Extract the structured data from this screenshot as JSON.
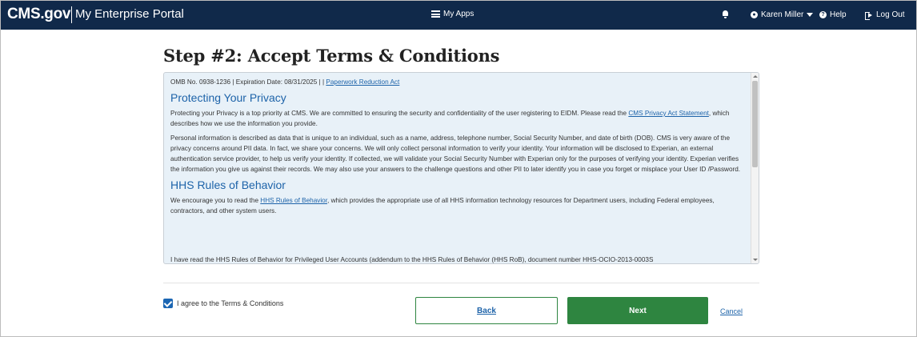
{
  "header": {
    "brand": "CMS.gov",
    "portal": "My Enterprise Portal",
    "my_apps": "My Apps",
    "user_name": "Karen Miller",
    "help": "Help",
    "logout": "Log Out"
  },
  "page": {
    "title": "Step #2: Accept Terms & Conditions"
  },
  "terms": {
    "omb_line": "OMB No. 0938-1236 | Expiration Date: 08/31/2025 | |",
    "omb_link": "Paperwork Reduction Act",
    "privacy_heading": "Protecting Your Privacy",
    "privacy_p1_pre": "Protecting your Privacy is a top priority at CMS. We are committed to ensuring the security and confidentiality of the user registering to EIDM. Please read the",
    "privacy_p1_link": "CMS Privacy Act Statement",
    "privacy_p1_post": ", which describes how we use the information you provide.",
    "privacy_p2": "Personal information is described as data that is unique to an individual, such as a name, address, telephone number, Social Security Number, and date of birth (DOB). CMS is very aware of the privacy concerns around PII data. In fact, we share your concerns. We will only collect personal information to verify your identity. Your information will be disclosed to Experian, an external authentication service provider, to help us verify your identity. If collected, we will validate your Social Security Number with Experian only for the purposes of verifying your identity. Experian verifies the information you give us against their records. We may also use your answers to the challenge questions and other PII to later identify you in case you forget or misplace your User ID /Password.",
    "hhs_heading": "HHS Rules of Behavior",
    "hhs_p1_pre": "We encourage you to read the",
    "hhs_p1_link": "HHS Rules of Behavior",
    "hhs_p1_post": ", which provides the appropriate use of all HHS information technology resources for Department users, including Federal employees, contractors, and other system users.",
    "hhs_p2_partial": "I have read the HHS Rules of Behavior for Privileged User Accounts (addendum to the HHS Rules of Behavior (HHS RoB), document number HHS-OCIO-2013-0003S"
  },
  "agreement": {
    "checkbox_label": "I agree to the Terms & Conditions",
    "checked": true
  },
  "actions": {
    "back": "Back",
    "next": "Next",
    "cancel": "Cancel"
  },
  "colors": {
    "header_bg": "#10294a",
    "link": "#1d63a9",
    "primary_button": "#2e8540",
    "terms_bg": "#e8f1f8"
  }
}
